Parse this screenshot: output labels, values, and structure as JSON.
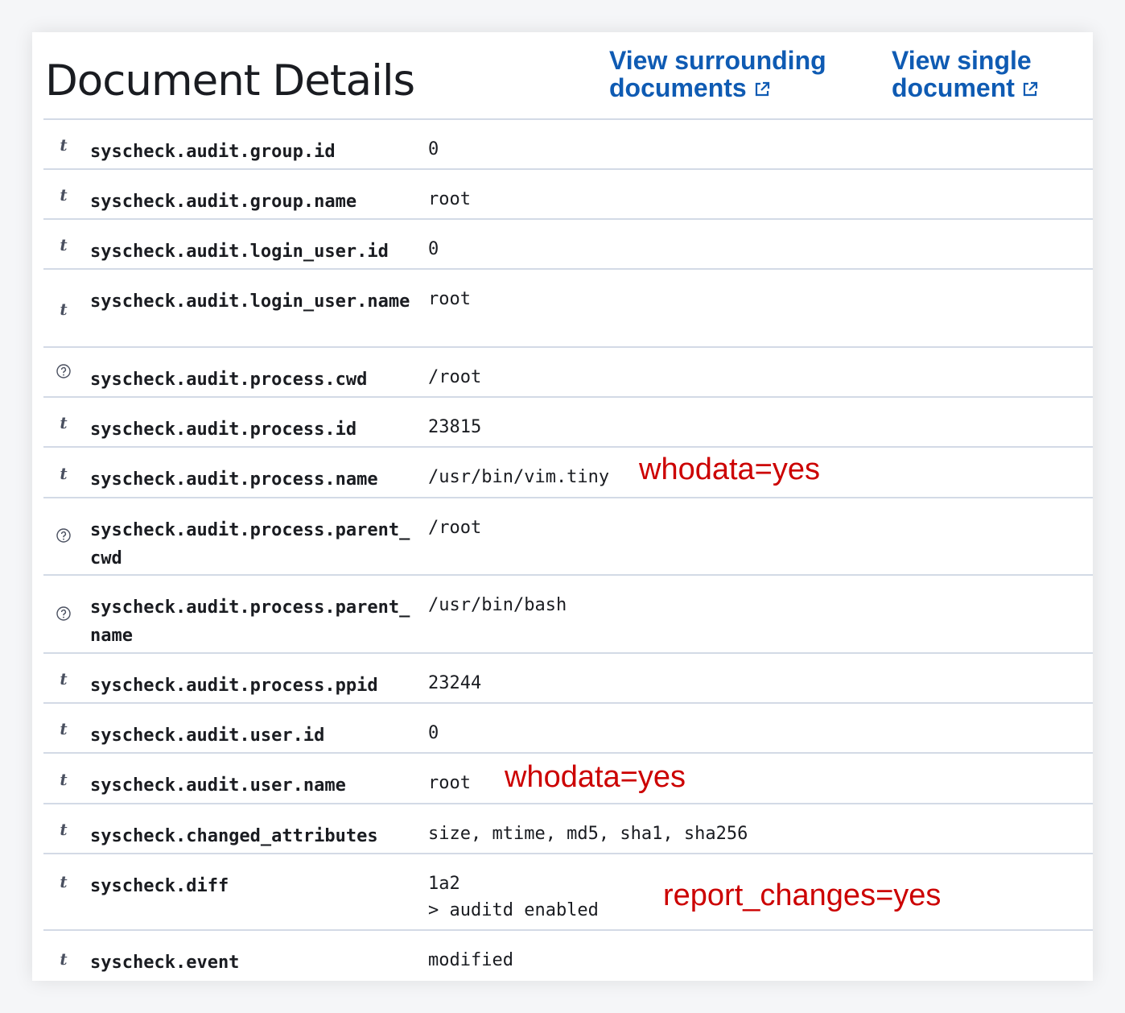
{
  "header": {
    "title": "Document Details",
    "link_surrounding": "View surrounding documents",
    "link_single": "View single document"
  },
  "rows": [
    {
      "type": "t",
      "field": "syscheck.audit.group.id",
      "value": "0"
    },
    {
      "type": "t",
      "field": "syscheck.audit.group.name",
      "value": "root"
    },
    {
      "type": "t",
      "field": "syscheck.audit.login_user.id",
      "value": "0"
    },
    {
      "type": "t",
      "field": "syscheck.audit.login_user.name",
      "value": "root"
    },
    {
      "type": "?",
      "field": "syscheck.audit.process.cwd",
      "value": "/root"
    },
    {
      "type": "t",
      "field": "syscheck.audit.process.id",
      "value": "23815"
    },
    {
      "type": "t",
      "field": "syscheck.audit.process.name",
      "value": "/usr/bin/vim.tiny"
    },
    {
      "type": "?",
      "field": "syscheck.audit.process.parent_cwd",
      "value": "/root"
    },
    {
      "type": "?",
      "field": "syscheck.audit.process.parent_name",
      "value": "/usr/bin/bash"
    },
    {
      "type": "t",
      "field": "syscheck.audit.process.ppid",
      "value": "23244"
    },
    {
      "type": "t",
      "field": "syscheck.audit.user.id",
      "value": "0"
    },
    {
      "type": "t",
      "field": "syscheck.audit.user.name",
      "value": "root"
    },
    {
      "type": "t",
      "field": "syscheck.changed_attributes",
      "value": "size, mtime, md5, sha1, sha256"
    },
    {
      "type": "t",
      "field": "syscheck.diff",
      "value": "1a2\n> auditd enabled"
    },
    {
      "type": "t",
      "field": "syscheck.event",
      "value": "modified"
    }
  ],
  "annotations": {
    "process_name_note": "whodata=yes",
    "user_name_note": "whodata=yes",
    "diff_note": "report_changes=yes"
  },
  "colors": {
    "link": "#0f5bb3",
    "annotation": "#cc0000",
    "divider": "#d3dae6"
  }
}
